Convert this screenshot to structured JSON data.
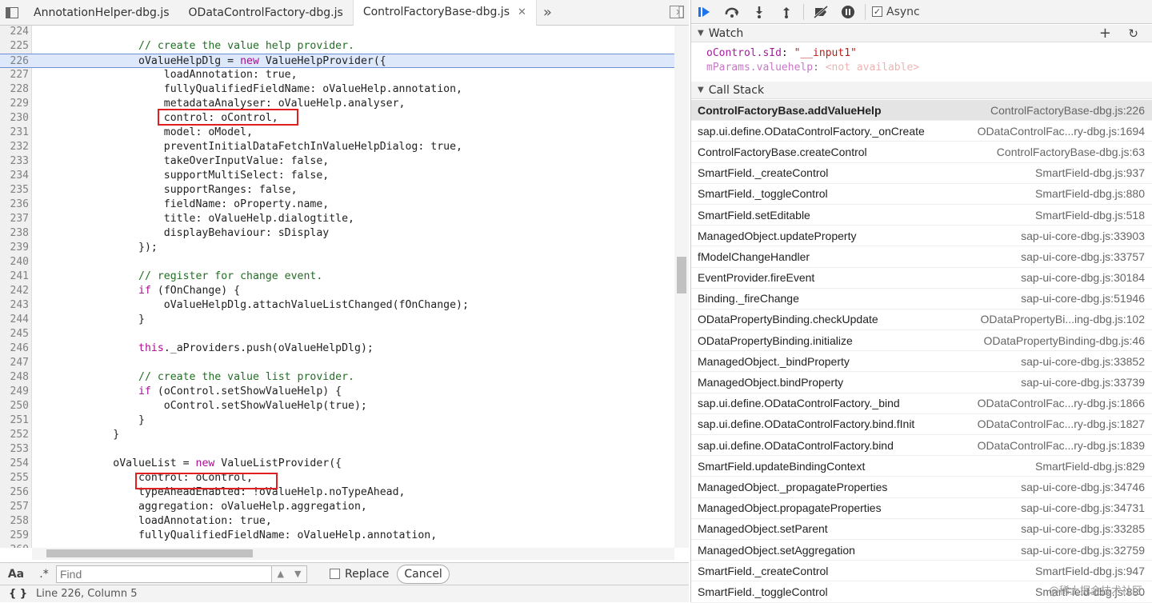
{
  "tabs": [
    "AnnotationHelper-dbg.js",
    "ODataControlFactory-dbg.js",
    "ControlFactoryBase-dbg.js"
  ],
  "active_tab": 2,
  "overflow": "»",
  "code": [
    {
      "n": "224",
      "t": ""
    },
    {
      "n": "225",
      "t": "                // create the value help provider.",
      "cls": "cm"
    },
    {
      "n": "226",
      "t": "                oValueHelpDlg = new ValueHelpProvider({",
      "hl": true
    },
    {
      "n": "227",
      "t": "                    loadAnnotation: true,"
    },
    {
      "n": "228",
      "t": "                    fullyQualifiedFieldName: oValueHelp.annotation,"
    },
    {
      "n": "229",
      "t": "                    metadataAnalyser: oValueHelp.analyser,"
    },
    {
      "n": "230",
      "t": "                    control: oControl,"
    },
    {
      "n": "231",
      "t": "                    model: oModel,"
    },
    {
      "n": "232",
      "t": "                    preventInitialDataFetchInValueHelpDialog: true,"
    },
    {
      "n": "233",
      "t": "                    takeOverInputValue: false,"
    },
    {
      "n": "234",
      "t": "                    supportMultiSelect: false,"
    },
    {
      "n": "235",
      "t": "                    supportRanges: false,"
    },
    {
      "n": "236",
      "t": "                    fieldName: oProperty.name,"
    },
    {
      "n": "237",
      "t": "                    title: oValueHelp.dialogtitle,"
    },
    {
      "n": "238",
      "t": "                    displayBehaviour: sDisplay"
    },
    {
      "n": "239",
      "t": "                });"
    },
    {
      "n": "240",
      "t": ""
    },
    {
      "n": "241",
      "t": "                // register for change event.",
      "cls": "cm"
    },
    {
      "n": "242",
      "t": "                if (fOnChange) {"
    },
    {
      "n": "243",
      "t": "                    oValueHelpDlg.attachValueListChanged(fOnChange);"
    },
    {
      "n": "244",
      "t": "                }"
    },
    {
      "n": "245",
      "t": ""
    },
    {
      "n": "246",
      "t": "                this._aProviders.push(oValueHelpDlg);"
    },
    {
      "n": "247",
      "t": ""
    },
    {
      "n": "248",
      "t": "                // create the value list provider.",
      "cls": "cm"
    },
    {
      "n": "249",
      "t": "                if (oControl.setShowValueHelp) {"
    },
    {
      "n": "250",
      "t": "                    oControl.setShowValueHelp(true);"
    },
    {
      "n": "251",
      "t": "                }"
    },
    {
      "n": "252",
      "t": "            }"
    },
    {
      "n": "253",
      "t": ""
    },
    {
      "n": "254",
      "t": "            oValueList = new ValueListProvider({"
    },
    {
      "n": "255",
      "t": "                control: oControl,"
    },
    {
      "n": "256",
      "t": "                typeAheadEnabled: !oValueHelp.noTypeAhead,"
    },
    {
      "n": "257",
      "t": "                aggregation: oValueHelp.aggregation,"
    },
    {
      "n": "258",
      "t": "                loadAnnotation: true,"
    },
    {
      "n": "259",
      "t": "                fullyQualifiedFieldName: oValueHelp.annotation,"
    },
    {
      "n": "260",
      "t": ""
    }
  ],
  "find": {
    "aa": "Aa",
    "regex": ".*",
    "placeholder": "Find",
    "replace_label": "Replace",
    "cancel_label": "Cancel"
  },
  "status": {
    "braces": "{ }",
    "position": "Line 226, Column 5"
  },
  "toolbar": {
    "async_label": "Async"
  },
  "watch": {
    "title": "Watch",
    "items": [
      {
        "name": "oControl.sId",
        "value": "\"__input1\""
      },
      {
        "name": "mParams.valuehelp",
        "value": "<not available>"
      }
    ]
  },
  "callstack": {
    "title": "Call Stack",
    "frames": [
      {
        "fn": "ControlFactoryBase.addValueHelp",
        "loc": "ControlFactoryBase-dbg.js:226"
      },
      {
        "fn": "sap.ui.define.ODataControlFactory._onCreate",
        "loc": "ODataControlFac...ry-dbg.js:1694"
      },
      {
        "fn": "ControlFactoryBase.createControl",
        "loc": "ControlFactoryBase-dbg.js:63"
      },
      {
        "fn": "SmartField._createControl",
        "loc": "SmartField-dbg.js:937"
      },
      {
        "fn": "SmartField._toggleControl",
        "loc": "SmartField-dbg.js:880"
      },
      {
        "fn": "SmartField.setEditable",
        "loc": "SmartField-dbg.js:518"
      },
      {
        "fn": "ManagedObject.updateProperty",
        "loc": "sap-ui-core-dbg.js:33903"
      },
      {
        "fn": "fModelChangeHandler",
        "loc": "sap-ui-core-dbg.js:33757"
      },
      {
        "fn": "EventProvider.fireEvent",
        "loc": "sap-ui-core-dbg.js:30184"
      },
      {
        "fn": "Binding._fireChange",
        "loc": "sap-ui-core-dbg.js:51946"
      },
      {
        "fn": "ODataPropertyBinding.checkUpdate",
        "loc": "ODataPropertyBi...ing-dbg.js:102"
      },
      {
        "fn": "ODataPropertyBinding.initialize",
        "loc": "ODataPropertyBinding-dbg.js:46"
      },
      {
        "fn": "ManagedObject._bindProperty",
        "loc": "sap-ui-core-dbg.js:33852"
      },
      {
        "fn": "ManagedObject.bindProperty",
        "loc": "sap-ui-core-dbg.js:33739"
      },
      {
        "fn": "sap.ui.define.ODataControlFactory._bind",
        "loc": "ODataControlFac...ry-dbg.js:1866"
      },
      {
        "fn": "sap.ui.define.ODataControlFactory.bind.fInit",
        "loc": "ODataControlFac...ry-dbg.js:1827"
      },
      {
        "fn": "sap.ui.define.ODataControlFactory.bind",
        "loc": "ODataControlFac...ry-dbg.js:1839"
      },
      {
        "fn": "SmartField.updateBindingContext",
        "loc": "SmartField-dbg.js:829"
      },
      {
        "fn": "ManagedObject._propagateProperties",
        "loc": "sap-ui-core-dbg.js:34746"
      },
      {
        "fn": "ManagedObject.propagateProperties",
        "loc": "sap-ui-core-dbg.js:34731"
      },
      {
        "fn": "ManagedObject.setParent",
        "loc": "sap-ui-core-dbg.js:33285"
      },
      {
        "fn": "ManagedObject.setAggregation",
        "loc": "sap-ui-core-dbg.js:32759"
      },
      {
        "fn": "SmartField._createControl",
        "loc": "SmartField-dbg.js:947"
      },
      {
        "fn": "SmartField._toggleControl",
        "loc": "SmartField-dbg.js:880"
      }
    ]
  },
  "watermark": "@稀土掘金技术社区"
}
